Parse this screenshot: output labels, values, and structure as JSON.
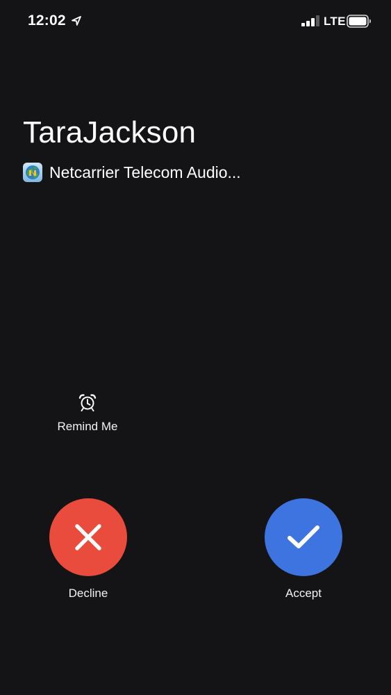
{
  "status_bar": {
    "time": "12:02",
    "network": "LTE",
    "location_icon": "location-arrow-icon",
    "signal_icon": "cellular-signal-icon",
    "battery_icon": "battery-icon"
  },
  "call": {
    "caller_name": "TaraJackson",
    "app_icon": "netcarrier-app-icon",
    "app_label": "Netcarrier Telecom Audio..."
  },
  "actions": {
    "remind_icon": "alarm-clock-icon",
    "remind_label": "Remind Me",
    "decline_label": "Decline",
    "decline_icon": "close-icon",
    "accept_label": "Accept",
    "accept_icon": "checkmark-icon"
  },
  "colors": {
    "background": "#141416",
    "decline": "#e94b3c",
    "accept": "#3d74e0",
    "text": "#ffffff"
  }
}
